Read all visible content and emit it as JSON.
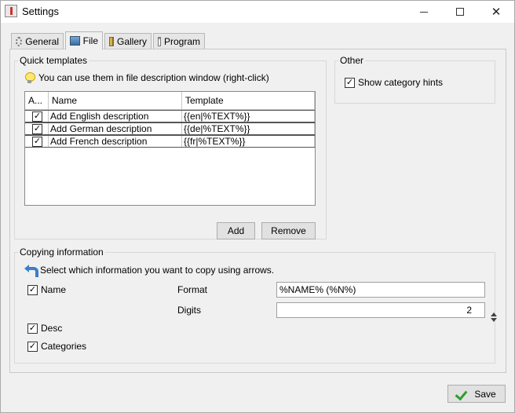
{
  "window": {
    "title": "Settings",
    "minimize": "—",
    "maximize": "☐",
    "close": "✕"
  },
  "tabs": [
    {
      "label": "General",
      "icon": "gear-icon"
    },
    {
      "label": "File",
      "icon": "file-icon",
      "active": true
    },
    {
      "label": "Gallery",
      "icon": "gallery-icon"
    },
    {
      "label": "Program",
      "icon": "window-icon"
    }
  ],
  "quick_templates": {
    "legend": "Quick templates",
    "hint": "You can use them in file description window (right-click)",
    "columns": [
      "A...",
      "Name",
      "Template"
    ],
    "rows": [
      {
        "active": "✓",
        "name": "Add English description",
        "template": "{{en|%TEXT%}}"
      },
      {
        "active": "✓",
        "name": "Add German description",
        "template": "{{de|%TEXT%}}"
      },
      {
        "active": "✓",
        "name": "Add French description",
        "template": "{{fr|%TEXT%}}"
      }
    ],
    "add_label": "Add",
    "remove_label": "Remove"
  },
  "other": {
    "legend": "Other",
    "show_category_hints": {
      "label": "Show category hints",
      "checked": "✓"
    }
  },
  "copying": {
    "legend": "Copying information",
    "hint": "Select which information you want to copy using arrows.",
    "name": {
      "label": "Name",
      "checked": "✓"
    },
    "desc": {
      "label": "Desc",
      "checked": "✓"
    },
    "categories": {
      "label": "Categories",
      "checked": "✓"
    },
    "format_label": "Format",
    "format_value": "%NAME% (%N%)",
    "digits_label": "Digits",
    "digits_value": "2"
  },
  "save_label": "Save"
}
